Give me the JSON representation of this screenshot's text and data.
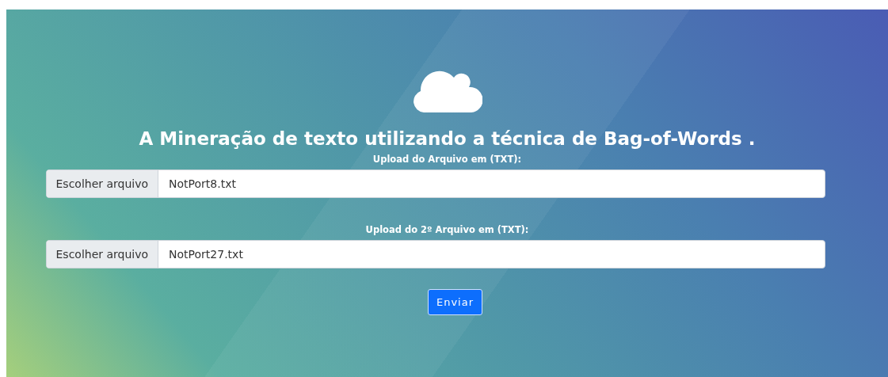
{
  "title": "A Mineração de texto utilizando a técnica de Bag-of-Words .",
  "uploads": [
    {
      "label": "Upload do Arquivo em (TXT):",
      "button": "Escolher arquivo",
      "value": "NotPort8.txt"
    },
    {
      "label": "Upload do 2º Arquivo em (TXT):",
      "button": "Escolher arquivo",
      "value": "NotPort27.txt"
    }
  ],
  "submit": "Enviar"
}
